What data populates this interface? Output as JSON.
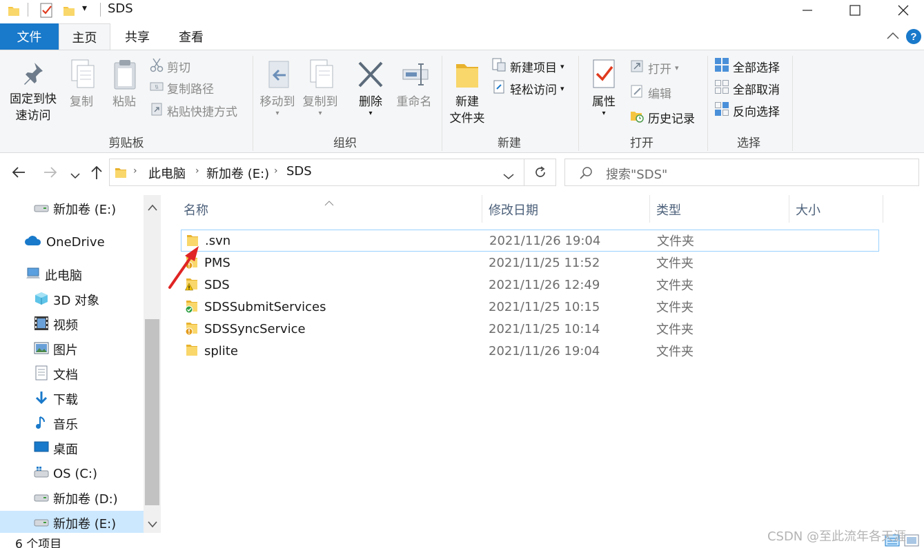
{
  "window": {
    "title": "SDS",
    "minimize_label": "—",
    "maximize_label": "☐",
    "close_label": "✕",
    "qat_dropdown": "▾"
  },
  "tabs": {
    "file": "文件",
    "home": "主页",
    "share": "共享",
    "view": "查看"
  },
  "ribbon": {
    "clipboard": {
      "group_label": "剪贴板",
      "pin_line1": "固定到快",
      "pin_line2": "速访问",
      "copy": "复制",
      "paste": "粘贴",
      "cut": "剪切",
      "copy_path": "复制路径",
      "paste_shortcut": "粘贴快捷方式"
    },
    "organize": {
      "group_label": "组织",
      "move_to": "移动到",
      "copy_to": "复制到",
      "delete": "删除",
      "rename": "重命名"
    },
    "new": {
      "group_label": "新建",
      "new_folder_line1": "新建",
      "new_folder_line2": "文件夹",
      "new_item": "新建项目",
      "easy_access": "轻松访问"
    },
    "open": {
      "group_label": "打开",
      "properties": "属性",
      "open": "打开",
      "edit": "编辑",
      "history": "历史记录"
    },
    "select": {
      "group_label": "选择",
      "select_all": "全部选择",
      "select_none": "全部取消",
      "invert": "反向选择"
    }
  },
  "address": {
    "crumbs": [
      "此电脑",
      "新加卷 (E:)",
      "SDS"
    ],
    "search_placeholder": "搜索\"SDS\""
  },
  "nav": {
    "items": [
      {
        "label": "新加卷 (E:)"
      },
      {
        "label": "OneDrive"
      },
      {
        "label": "此电脑"
      },
      {
        "label": "3D 对象"
      },
      {
        "label": "视频"
      },
      {
        "label": "图片"
      },
      {
        "label": "文档"
      },
      {
        "label": "下载"
      },
      {
        "label": "音乐"
      },
      {
        "label": "桌面"
      },
      {
        "label": "OS (C:)"
      },
      {
        "label": "新加卷 (D:)"
      },
      {
        "label": "新加卷 (E:)"
      }
    ]
  },
  "columns": {
    "name": "名称",
    "modified": "修改日期",
    "type": "类型",
    "size": "大小"
  },
  "files": [
    {
      "name": ".svn",
      "modified": "2021/11/26 19:04",
      "type": "文件夹",
      "overlay": "none"
    },
    {
      "name": "PMS",
      "modified": "2021/11/25 11:52",
      "type": "文件夹",
      "overlay": "modified-icon"
    },
    {
      "name": "SDS",
      "modified": "2021/11/26 12:49",
      "type": "文件夹",
      "overlay": "warning-icon"
    },
    {
      "name": "SDSSubmitServices",
      "modified": "2021/11/25 10:15",
      "type": "文件夹",
      "overlay": "normal-check-icon"
    },
    {
      "name": "SDSSyncService",
      "modified": "2021/11/25 10:14",
      "type": "文件夹",
      "overlay": "modified-icon"
    },
    {
      "name": "splite",
      "modified": "2021/11/26 19:04",
      "type": "文件夹",
      "overlay": "none"
    }
  ],
  "status": {
    "item_count": "6 个项目"
  },
  "watermark": "CSDN @至此流年各天涯",
  "colors": {
    "accent": "#1979ca",
    "folder": "#f5c542",
    "annotation_arrow": "#e02424"
  }
}
